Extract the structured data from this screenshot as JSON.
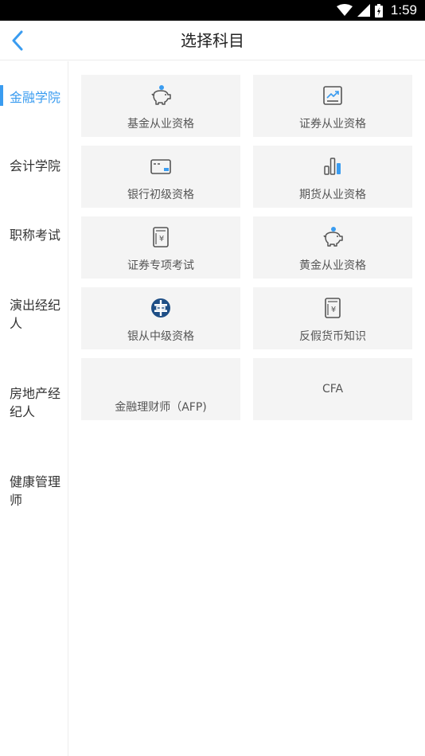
{
  "status_bar": {
    "time": "1:59"
  },
  "header": {
    "title": "选择科目"
  },
  "sidebar": {
    "items": [
      {
        "label": "金融学院"
      },
      {
        "label": "会计学院"
      },
      {
        "label": "职称考试"
      },
      {
        "label": "演出经纪人"
      },
      {
        "label": "房地产经纪人"
      },
      {
        "label": "健康管理师"
      }
    ],
    "active_index": 0
  },
  "subjects": [
    {
      "label": "基金从业资格",
      "icon": "piggy-bank-icon"
    },
    {
      "label": "证券从业资格",
      "icon": "stock-chart-icon"
    },
    {
      "label": "银行初级资格",
      "icon": "bank-card-icon"
    },
    {
      "label": "期货从业资格",
      "icon": "bar-chart-icon"
    },
    {
      "label": "证券专项考试",
      "icon": "yuan-book-icon"
    },
    {
      "label": "黄金从业资格",
      "icon": "piggy-bank-icon"
    },
    {
      "label": "银从中级资格",
      "icon": "bank-logo-icon"
    },
    {
      "label": "反假货币知识",
      "icon": "yuan-book-icon"
    },
    {
      "label": "金融理财师（AFP)",
      "icon": ""
    },
    {
      "label": "CFA",
      "icon": ""
    }
  ],
  "colors": {
    "accent": "#3a9cf0",
    "card_bg": "#f4f4f4",
    "icon_dark": "#555555",
    "bank_logo": "#1f4f86"
  }
}
